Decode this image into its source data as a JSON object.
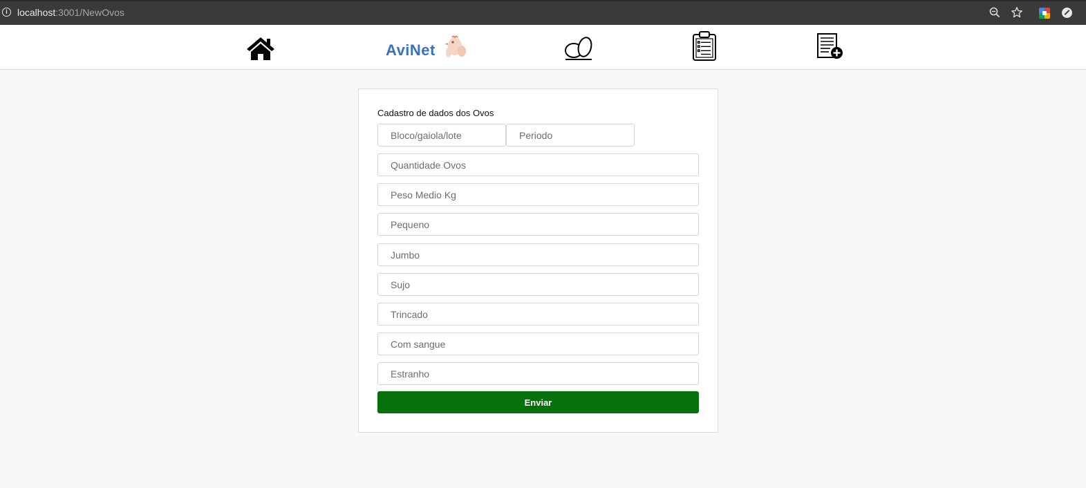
{
  "browser": {
    "url_host": "localhost",
    "url_rest": ":3001/NewOvos"
  },
  "nav": {
    "logo_text": "AviNet",
    "items": [
      {
        "icon": "home-icon"
      },
      {
        "icon": "eggs-icon"
      },
      {
        "icon": "clipboard-list-icon"
      },
      {
        "icon": "add-document-icon"
      }
    ]
  },
  "form": {
    "title": "Cadastro de dados dos Ovos",
    "fields": {
      "bloco": {
        "placeholder": "Bloco/gaiola/lote",
        "value": ""
      },
      "periodo": {
        "placeholder": "Periodo",
        "value": ""
      },
      "quantidade": {
        "placeholder": "Quantidade Ovos",
        "value": ""
      },
      "peso": {
        "placeholder": "Peso Medio Kg",
        "value": ""
      },
      "pequeno": {
        "placeholder": "Pequeno",
        "value": ""
      },
      "jumbo": {
        "placeholder": "Jumbo",
        "value": ""
      },
      "sujo": {
        "placeholder": "Sujo",
        "value": ""
      },
      "trincado": {
        "placeholder": "Trincado",
        "value": ""
      },
      "com_sangue": {
        "placeholder": "Com sangue",
        "value": ""
      },
      "estranho": {
        "placeholder": "Estranho",
        "value": ""
      }
    },
    "submit_label": "Enviar",
    "submit_color": "#06700b"
  }
}
